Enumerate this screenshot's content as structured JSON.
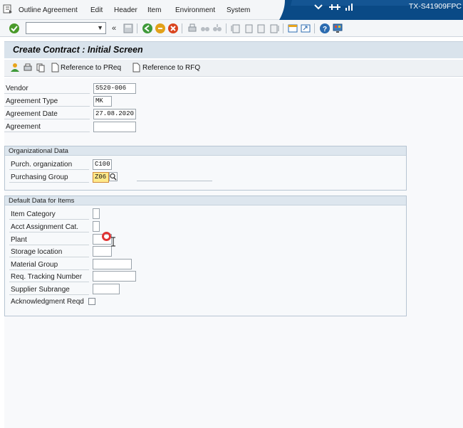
{
  "menu": {
    "items": [
      "Outline Agreement",
      "Edit",
      "Header",
      "Item",
      "Environment",
      "System"
    ],
    "system_id": "TX-S41909FPC"
  },
  "toolbar": {
    "command_field_value": ""
  },
  "title": "Create Contract : Initial Screen",
  "app_toolbar": {
    "ref_preq": "Reference to PReq",
    "ref_rfq": "Reference to RFQ"
  },
  "header_fields": {
    "vendor_label": "Vendor",
    "vendor_value": "S520-006",
    "agreement_type_label": "Agreement Type",
    "agreement_type_value": "MK",
    "agreement_date_label": "Agreement Date",
    "agreement_date_value": "27.08.2020",
    "agreement_label": "Agreement",
    "agreement_value": ""
  },
  "org_data": {
    "title": "Organizational Data",
    "purch_org_label": "Purch. organization",
    "purch_org_value": "C100",
    "purch_group_label": "Purchasing Group",
    "purch_group_value": "Z06"
  },
  "default_data": {
    "title": "Default Data for Items",
    "item_category_label": "Item Category",
    "acct_assign_label": "Acct Assignment Cat.",
    "plant_label": "Plant",
    "storage_location_label": "Storage location",
    "material_group_label": "Material Group",
    "req_tracking_label": "Req. Tracking Number",
    "supplier_subrange_label": "Supplier Subrange",
    "ack_reqd_label": "Acknowledgment Reqd"
  },
  "colors": {
    "title_bar_blue": "#0a4a86",
    "highlight_field": "#ffe98a",
    "cursor_ring": "#e03434"
  }
}
